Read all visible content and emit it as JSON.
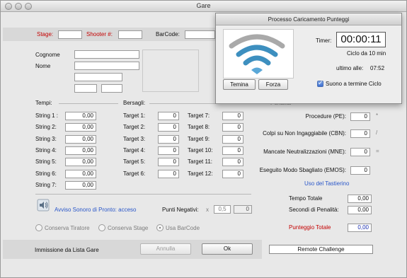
{
  "window": {
    "title": "Gare"
  },
  "header": {
    "stage_label": "Stage:",
    "shooter_label": "Shooter #:",
    "barcode_label": "BarCode:"
  },
  "shooter": {
    "surname_label": "Cognome",
    "name_label": "Nome"
  },
  "tempi": {
    "section_label": "Tempi:",
    "strings": [
      {
        "label": "String 1 :",
        "value": "0,00"
      },
      {
        "label": "String 2:",
        "value": "0,00"
      },
      {
        "label": "String 3:",
        "value": "0,00"
      },
      {
        "label": "String 4:",
        "value": "0,00"
      },
      {
        "label": "String 5:",
        "value": "0,00"
      },
      {
        "label": "String 6:",
        "value": "0,00"
      },
      {
        "label": "String 7:",
        "value": "0,00"
      }
    ]
  },
  "bersagli": {
    "section_label": "Bersagli:",
    "left": [
      {
        "label": "Target  1:",
        "value": "0"
      },
      {
        "label": "Target  2:",
        "value": "0"
      },
      {
        "label": "Target  3:",
        "value": "0"
      },
      {
        "label": "Target  4:",
        "value": "0"
      },
      {
        "label": "Target  5:",
        "value": "0"
      },
      {
        "label": "Target  6:",
        "value": "0"
      }
    ],
    "right": [
      {
        "label": "Target  7:",
        "value": "0"
      },
      {
        "label": "Target  8:",
        "value": "0"
      },
      {
        "label": "Target  9:",
        "value": "0"
      },
      {
        "label": "Target 10:",
        "value": "0"
      },
      {
        "label": "Target 11:",
        "value": "0"
      },
      {
        "label": "Target 12:",
        "value": "0"
      }
    ]
  },
  "penalita": {
    "section_label": "Penalita'",
    "items": [
      {
        "label": "Procedure (PE):",
        "value": "0",
        "symbol": "*"
      },
      {
        "label": "Colpi su Non Ingaggiabile (CBN):",
        "value": "0",
        "symbol": "/"
      },
      {
        "label": "Mancate Neutralizzazioni (MNE):",
        "value": "0",
        "symbol": "="
      },
      {
        "label": "Eseguito Modo Sbagliato (EMOS):",
        "value": "0",
        "symbol": ""
      }
    ],
    "keypad_link": "Uso del Tastierino"
  },
  "totals": {
    "tempo_totale_label": "Tempo Totale",
    "tempo_totale": "0,00",
    "penalita_label": "Secondi di Penalità:",
    "penalita": "0,00",
    "punteggio_label": "Punteggio Totale",
    "punteggio": "0,00"
  },
  "sound": {
    "label": "Avviso Sonoro di Pronto: acceso",
    "icon": "speaker-icon"
  },
  "negative": {
    "label": "Punti Negativi:",
    "mult": "x",
    "factor": "0,5",
    "value": "0"
  },
  "options": {
    "keep_shooter": "Conserva Tiratore",
    "keep_stage": "Conserva Stage",
    "use_barcode": "Usa BarCode",
    "selected": "use_barcode"
  },
  "footer": {
    "entry_label": "Immissione da Lista Gare",
    "cancel": "Annulla",
    "ok": "Ok",
    "remote": "Remote Challenge"
  },
  "popup": {
    "title": "Processo Caricamento Punteggi",
    "timer_label": "Timer:",
    "timer_value": "00:00:11",
    "cycle_text": "Ciclo da 10 min",
    "last_label": "ultimo alle:",
    "last_time": "07:52",
    "terminate": "Temina",
    "force": "Forza",
    "sound_checkbox": "Suono a termine Ciclo",
    "sound_checked": true,
    "wifi_colors": {
      "outer": "#a9a9a9",
      "middle": "#3d8fbf",
      "inner": "#3d8fbf",
      "dot": "#5aa8d8"
    }
  }
}
